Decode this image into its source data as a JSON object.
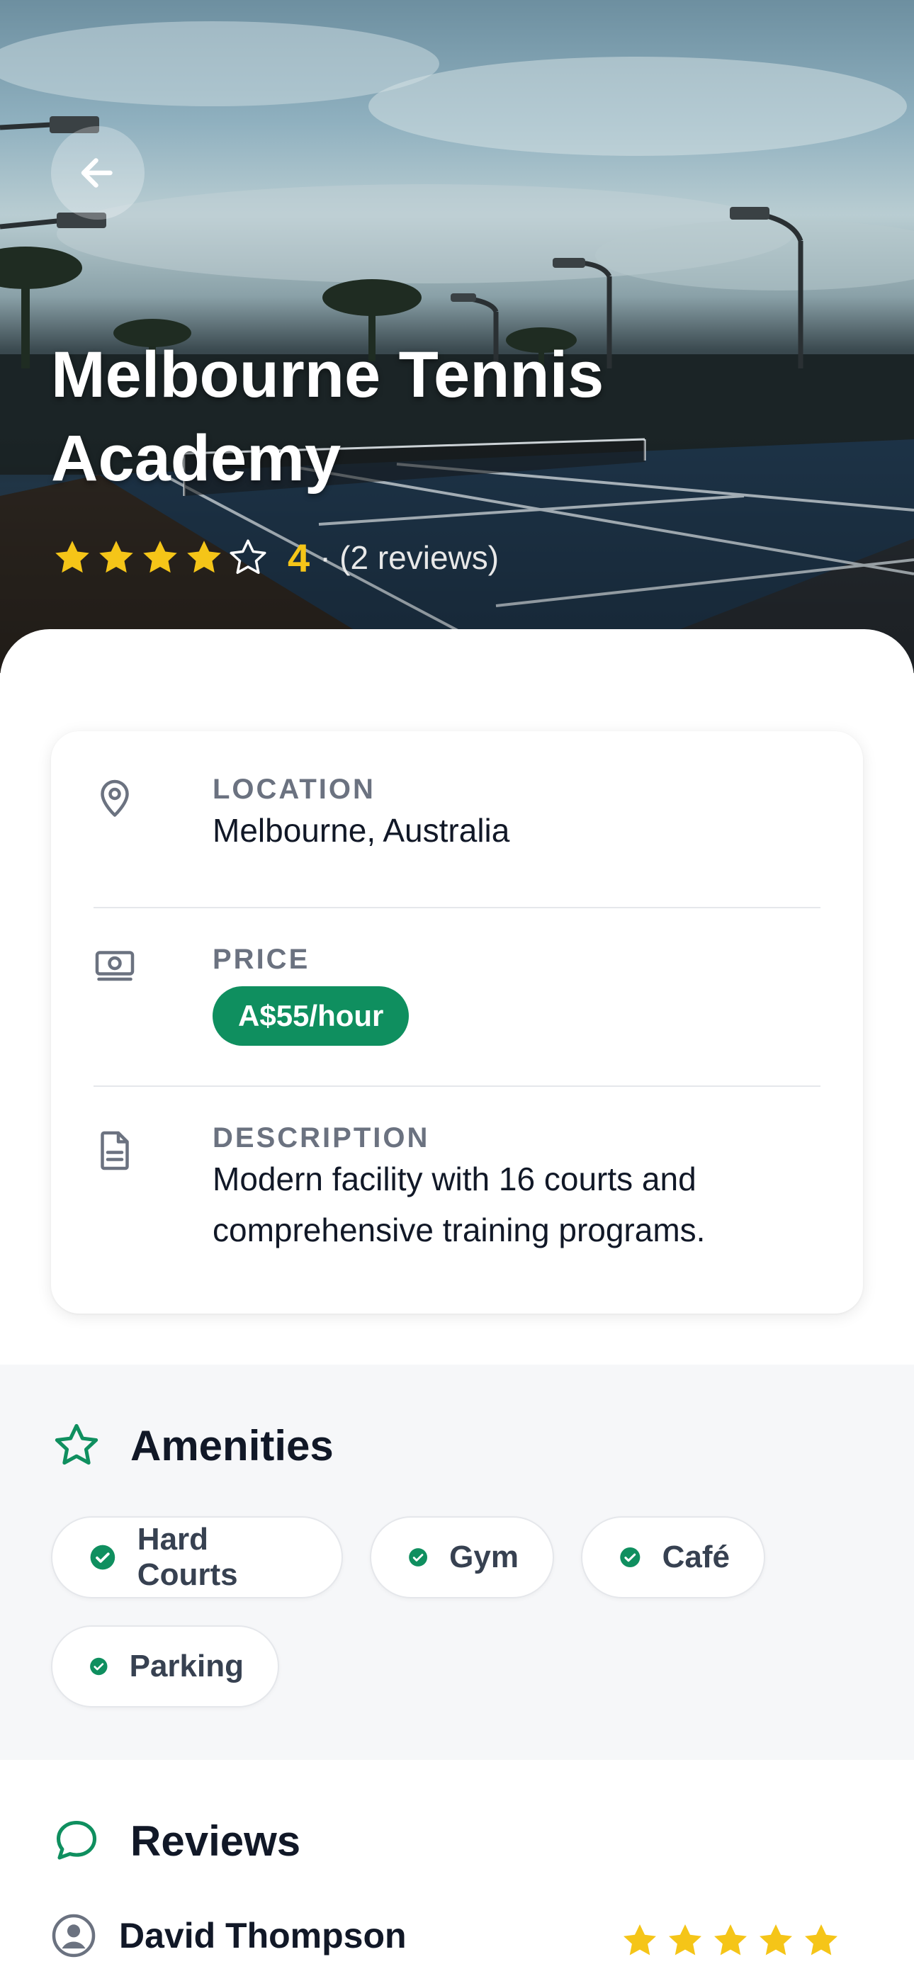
{
  "hero": {
    "title_line1": "Melbourne Tennis",
    "title_line2": "Academy",
    "rating_value": "4",
    "rating_separator": "·",
    "reviews_text": "(2 reviews)",
    "stars_filled": 4,
    "stars_total": 5,
    "back_icon": "arrow-left-icon"
  },
  "details": {
    "location": {
      "label": "LOCATION",
      "value": "Melbourne, Australia",
      "icon": "map-pin-icon"
    },
    "price": {
      "label": "PRICE",
      "value": "A$55/hour",
      "icon": "banknote-icon"
    },
    "description": {
      "label": "DESCRIPTION",
      "line1": "Modern facility with 16 courts and",
      "line2": "comprehensive training programs.",
      "icon": "document-icon"
    }
  },
  "amenities": {
    "title": "Amenities",
    "icon": "star-outline-icon",
    "items": [
      "Hard Courts",
      "Gym",
      "Café",
      "Parking"
    ]
  },
  "reviews": {
    "title": "Reviews",
    "icon": "chat-bubble-icon",
    "items": [
      {
        "name": "David Thompson",
        "stars": 5
      }
    ]
  },
  "colors": {
    "accent_green": "#0f8f5f",
    "star_yellow": "#f5c518",
    "text_dark": "#111827",
    "label_gray": "#6b7280"
  }
}
